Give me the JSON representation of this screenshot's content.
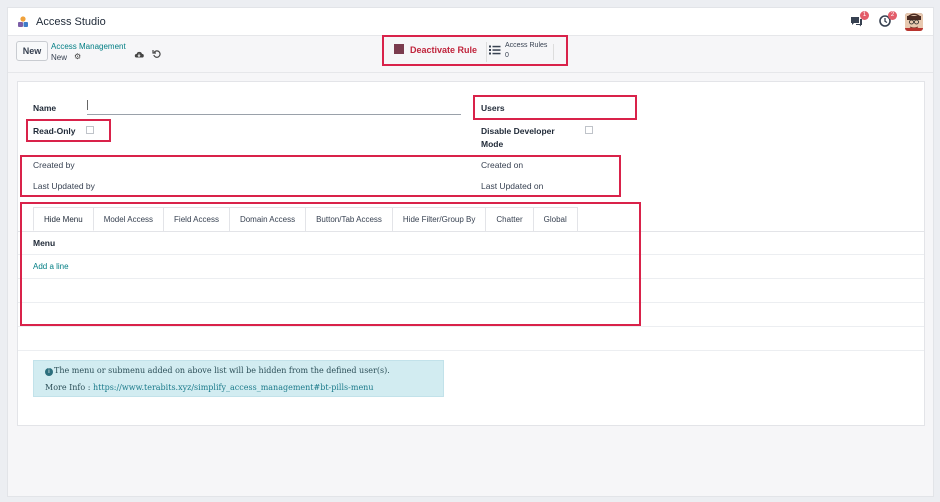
{
  "app": {
    "title": "Access Studio"
  },
  "systray": {
    "messages_count": "1",
    "activities_count": "2"
  },
  "controls": {
    "new_label": "New",
    "breadcrumb_parent": "Access Management",
    "breadcrumb_current": "New"
  },
  "stat_buttons": {
    "deactivate_label": "Deactivate Rule",
    "access_rules_label": "Access Rules",
    "access_rules_count": "0"
  },
  "form": {
    "name_label": "Name",
    "users_label": "Users",
    "read_only_label": "Read-Only",
    "disable_dev_label_1": "Disable Developer",
    "disable_dev_label_2": "Mode",
    "created_by_label": "Created by",
    "created_on_label": "Created on",
    "last_updated_by_label": "Last Updated by",
    "last_updated_on_label": "Last Updated on"
  },
  "tabs": [
    "Hide Menu",
    "Model Access",
    "Field Access",
    "Domain Access",
    "Button/Tab Access",
    "Hide Filter/Group By",
    "Chatter",
    "Global"
  ],
  "menu_table": {
    "column": "Menu",
    "add_line": "Add a line"
  },
  "alert": {
    "line1": "The menu or submenu added on above list will be hidden from the defined user(s).",
    "line2_prefix": "More Info : ",
    "line2_link": "https://www.terabits.xyz/simplify_access_management#bt-pills-menu"
  },
  "colors": {
    "accent": "#017e84",
    "highlight_border": "#d9224a",
    "alert_bg": "#d2ecf1"
  }
}
